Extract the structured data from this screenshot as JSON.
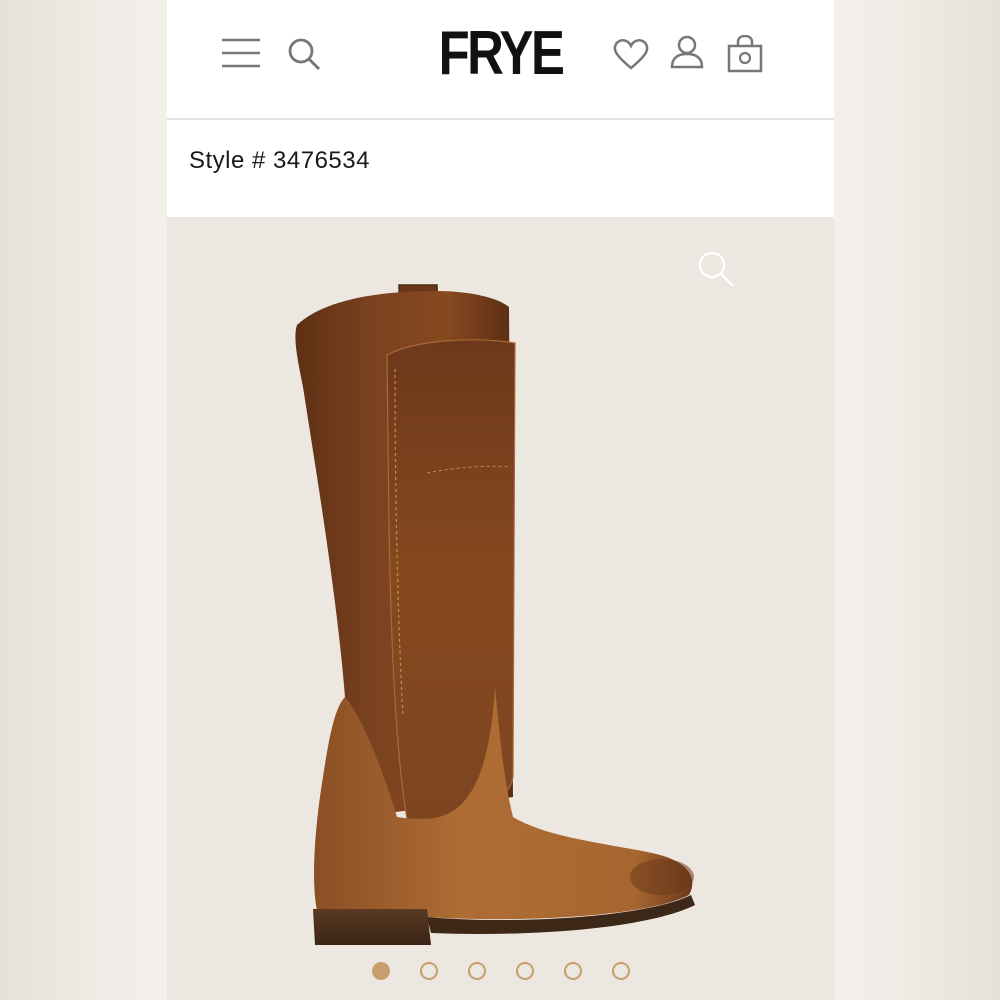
{
  "header": {
    "brand": "FRYE",
    "icons": [
      "menu-icon",
      "search-icon",
      "heart-icon",
      "account-icon",
      "bag-icon"
    ]
  },
  "product": {
    "style_label": "Style # 3476534",
    "zoom_icon": "zoom-icon",
    "image_alt": "brown leather tall riding boot",
    "carousel": {
      "total": 6,
      "active_index": 0
    }
  },
  "colors": {
    "accent_dot": "#c79e6c",
    "background": "#ece8e1",
    "boot_dark": "#6e3a1c",
    "boot_light": "#a4642f"
  }
}
